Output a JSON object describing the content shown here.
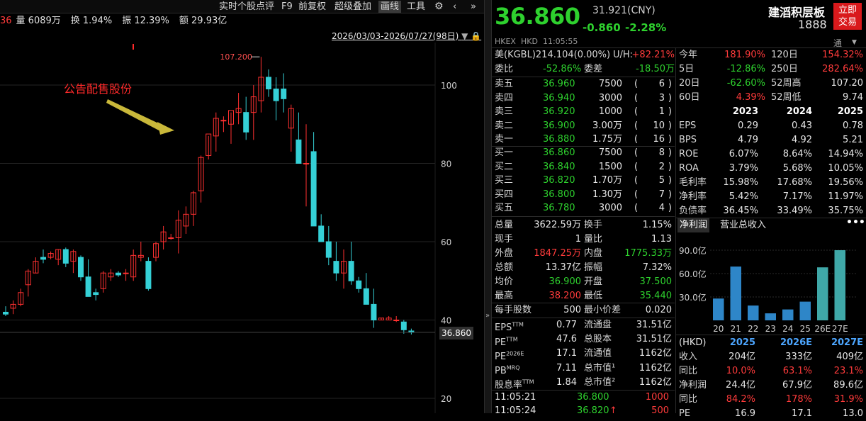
{
  "toolbar": {
    "items": [
      "实时个股点评",
      "F9",
      "前复权",
      "超级叠加",
      "画线",
      "工具"
    ],
    "selected": "画线"
  },
  "topstats": {
    "partial": "36",
    "volume": "量 6089万",
    "turnover": "换 1.94%",
    "amplitude": "振 12.39%",
    "amount": "额 29.93亿"
  },
  "chart_header": {
    "range": "2026/03/03-2026/07/27(98日)"
  },
  "chart_data": {
    "type": "candlestick",
    "title": "",
    "y_ticks": [
      100,
      80,
      60,
      40,
      20
    ],
    "ylim": [
      18,
      108
    ],
    "annotation": "公告配售股份",
    "high_label": "107.200",
    "last_price_label": "36.860",
    "candles": [
      [
        42,
        43.5,
        41,
        41.5
      ],
      [
        43,
        45,
        41.5,
        44
      ],
      [
        44,
        48,
        43.5,
        47
      ],
      [
        49,
        53,
        46,
        52.5
      ],
      [
        52,
        56,
        52,
        55
      ],
      [
        56,
        58,
        54.5,
        55.5
      ],
      [
        56,
        57.5,
        55.5,
        57
      ],
      [
        55.5,
        58,
        54,
        58
      ],
      [
        58,
        58.5,
        53.5,
        54.5
      ],
      [
        55,
        58,
        52,
        57.5
      ],
      [
        56,
        56.5,
        50,
        51
      ],
      [
        51,
        55.5,
        46,
        46
      ],
      [
        47,
        48,
        45,
        46.5
      ],
      [
        48,
        52.5,
        47,
        52
      ],
      [
        51,
        53,
        50,
        52
      ],
      [
        52,
        52.5,
        51,
        51.5
      ],
      [
        52,
        53,
        50,
        52
      ],
      [
        51,
        58,
        50,
        56.5
      ],
      [
        56,
        60,
        55,
        56.5
      ],
      [
        55,
        56,
        47.5,
        48
      ],
      [
        56,
        60,
        55,
        59.5
      ],
      [
        60,
        64,
        58,
        62.5
      ],
      [
        61,
        62,
        60.5,
        61
      ],
      [
        61,
        68,
        57,
        65.5
      ],
      [
        64,
        69,
        62,
        67
      ],
      [
        67,
        73,
        64,
        72.5
      ],
      [
        73,
        82,
        70,
        81.5
      ],
      [
        82,
        87,
        81,
        87.5
      ],
      [
        87,
        93,
        83,
        91.5
      ],
      [
        91,
        92,
        88,
        91
      ],
      [
        90,
        93,
        85,
        93.5
      ],
      [
        93,
        98,
        90,
        94
      ],
      [
        93,
        97,
        86,
        88
      ],
      [
        93,
        100,
        86,
        97
      ],
      [
        96,
        107.2,
        93,
        102
      ],
      [
        102,
        104,
        97,
        99
      ],
      [
        99,
        102,
        91,
        96
      ],
      [
        99,
        103,
        93,
        96.5
      ],
      [
        89,
        95,
        83,
        94
      ],
      [
        86,
        93,
        80,
        80
      ],
      [
        80,
        90,
        69,
        80
      ],
      [
        83,
        88,
        64,
        64
      ],
      [
        64,
        67,
        62,
        60
      ],
      [
        60,
        64,
        54,
        56
      ],
      [
        55,
        60,
        50,
        52
      ],
      [
        52,
        58,
        48,
        55
      ],
      [
        55,
        60,
        49,
        50
      ],
      [
        50,
        51,
        47,
        48
      ],
      [
        48,
        52,
        45,
        44
      ],
      [
        44,
        48,
        38,
        40
      ],
      [
        40,
        40.5,
        40,
        40.5
      ],
      [
        40,
        41,
        40,
        40.5
      ],
      [
        40,
        41,
        39.5,
        40
      ],
      [
        39.5,
        40,
        36.5,
        37.5
      ],
      [
        37.2,
        37.8,
        36.3,
        36.86
      ]
    ]
  },
  "quote": {
    "price": "36.860",
    "prev": "31.921(CNY)",
    "change": "-0.860",
    "change_pct": "-2.28%",
    "name": "建滔积层板",
    "code": "1888",
    "tong": "通",
    "trade_btn": "立即交易",
    "exchange": "HKEX",
    "currency": "HKD",
    "time": "11:05:55"
  },
  "adr": {
    "label": "美(KGBL)",
    "value": "214.104(0.00%)",
    "uh_label": "U/H:",
    "uh_value": "+82.21%"
  },
  "ratio": {
    "wb_label": "委比",
    "wb": "-52.86%",
    "wc_label": "委差",
    "wc": "-18.50万"
  },
  "asks": [
    {
      "l": "卖五",
      "p": "36.960",
      "v": "7500",
      "n": "6"
    },
    {
      "l": "卖四",
      "p": "36.940",
      "v": "3000",
      "n": "3"
    },
    {
      "l": "卖三",
      "p": "36.920",
      "v": "1000",
      "n": "1"
    },
    {
      "l": "卖二",
      "p": "36.900",
      "v": "3.00万",
      "n": "10"
    },
    {
      "l": "卖一",
      "p": "36.880",
      "v": "1.75万",
      "n": "16"
    }
  ],
  "bids": [
    {
      "l": "买一",
      "p": "36.860",
      "v": "7500",
      "n": "8"
    },
    {
      "l": "买二",
      "p": "36.840",
      "v": "1500",
      "n": "2"
    },
    {
      "l": "买三",
      "p": "36.820",
      "v": "1.70万",
      "n": "5"
    },
    {
      "l": "买四",
      "p": "36.800",
      "v": "1.30万",
      "n": "7"
    },
    {
      "l": "买五",
      "p": "36.780",
      "v": "3000",
      "n": "4"
    }
  ],
  "stats": [
    {
      "l1": "总量",
      "v1": "3622.59万",
      "c1": "wht",
      "l2": "换手",
      "v2": "1.15%",
      "c2": "wht"
    },
    {
      "l1": "现手",
      "v1": "1",
      "c1": "wht",
      "l2": "量比",
      "v2": "1.13",
      "c2": "wht"
    },
    {
      "l1": "外盘",
      "v1": "1847.25万",
      "c1": "red",
      "l2": "内盘",
      "v2": "1775.33万",
      "c2": "grn"
    },
    {
      "l1": "总额",
      "v1": "13.37亿",
      "c1": "wht",
      "l2": "振幅",
      "v2": "7.32%",
      "c2": "wht"
    },
    {
      "l1": "均价",
      "v1": "36.900",
      "c1": "grn",
      "l2": "开盘",
      "v2": "37.500",
      "c2": "grn"
    },
    {
      "l1": "最高",
      "v1": "38.200",
      "c1": "red",
      "l2": "最低",
      "v2": "35.440",
      "c2": "grn"
    }
  ],
  "lot": {
    "l1": "每手股数",
    "v1": "500",
    "l2": "最小价差",
    "v2": "0.020"
  },
  "valuation": [
    {
      "l1": "EPS",
      "s1": "TTM",
      "v1": "0.77",
      "l2": "流通盘",
      "v2": "31.51亿"
    },
    {
      "l1": "PE",
      "s1": "TTM",
      "v1": "47.6",
      "l2": "总股本",
      "v2": "31.51亿"
    },
    {
      "l1": "PE",
      "s1": "2026E",
      "v1": "17.1",
      "l2": "流通值",
      "v2": "1162亿"
    },
    {
      "l1": "PB",
      "s1": "MRQ",
      "v1": "7.11",
      "l2": "总市值¹",
      "v2": "1162亿"
    },
    {
      "l1": "股息率",
      "s1": "TTM",
      "v1": "1.84",
      "l2": "总市值²",
      "v2": "1162亿"
    }
  ],
  "ticks": [
    {
      "t": "11:05:21",
      "p": "36.800",
      "v": "1000",
      "arrow": ""
    },
    {
      "t": "11:05:24",
      "p": "36.820",
      "v": "500",
      "arrow": "↑"
    }
  ],
  "perf": [
    {
      "l1": "今年",
      "v1": "181.90%",
      "c1": "red",
      "l2": "120日",
      "v2": "154.32%",
      "c2": "red"
    },
    {
      "l1": "5日",
      "v1": "-12.86%",
      "c1": "grn",
      "l2": "250日",
      "v2": "282.64%",
      "c2": "red"
    },
    {
      "l1": "20日",
      "v1": "-62.60%",
      "c1": "grn",
      "l2": "52周高",
      "v2": "107.20",
      "c2": "wht"
    },
    {
      "l1": "60日",
      "v1": "4.39%",
      "c1": "red",
      "l2": "52周低",
      "v2": "9.74",
      "c2": "wht"
    }
  ],
  "fin_years": [
    "2023",
    "2024",
    "2025"
  ],
  "fin": [
    {
      "l": "EPS",
      "v": [
        "0.29",
        "0.43",
        "0.78"
      ]
    },
    {
      "l": "BPS",
      "v": [
        "4.79",
        "4.92",
        "5.21"
      ]
    },
    {
      "l": "ROE",
      "v": [
        "6.07%",
        "8.64%",
        "14.94%"
      ]
    },
    {
      "l": "ROA",
      "v": [
        "3.79%",
        "5.68%",
        "10.05%"
      ]
    },
    {
      "l": "毛利率",
      "v": [
        "15.98%",
        "17.68%",
        "19.56%"
      ]
    },
    {
      "l": "净利率",
      "v": [
        "5.42%",
        "7.17%",
        "11.97%"
      ]
    },
    {
      "l": "负债率",
      "v": [
        "36.45%",
        "33.49%",
        "35.75%"
      ]
    }
  ],
  "mini_tabs": [
    "净利润",
    "营业总收入"
  ],
  "mini_chart": {
    "type": "bar",
    "categories": [
      "20",
      "21",
      "22",
      "23",
      "24",
      "25",
      "26E",
      "27E"
    ],
    "values": [
      28,
      69,
      19,
      9,
      14,
      24,
      68,
      90
    ],
    "y_ticks": [
      "90.0亿",
      "60.0亿",
      "30.0亿"
    ],
    "ylim": [
      0,
      100
    ],
    "colors": [
      "#2e86c8",
      "#2e86c8",
      "#2e86c8",
      "#2e86c8",
      "#2e86c8",
      "#2e86c8",
      "#3fa8a8",
      "#3fa8a8"
    ]
  },
  "forecast": {
    "currency": "(HKD)",
    "years": [
      "2025",
      "2026E",
      "2027E"
    ],
    "rows": [
      {
        "l": "收入",
        "v": [
          "204亿",
          "333亿",
          "409亿"
        ],
        "c": "wht"
      },
      {
        "l": "同比",
        "v": [
          "10.0%",
          "63.1%",
          "23.1%"
        ],
        "c": "red"
      },
      {
        "l": "净利润",
        "v": [
          "24.4亿",
          "67.9亿",
          "89.6亿"
        ],
        "c": "wht"
      },
      {
        "l": "同比",
        "v": [
          "84.2%",
          "178%",
          "31.9%"
        ],
        "c": "red"
      },
      {
        "l": "PE",
        "v": [
          "16.9",
          "17.1",
          "13.0"
        ],
        "c": "wht"
      }
    ]
  },
  "colors": {
    "up": "#ff3b3b",
    "down": "#2ed12e",
    "bear_candle": "#35d0d6",
    "bull_candle": "#ff3030"
  }
}
